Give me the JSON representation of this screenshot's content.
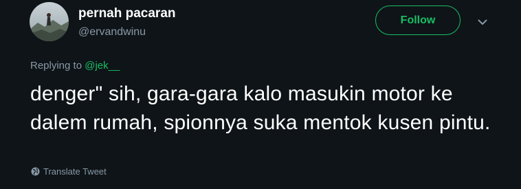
{
  "user": {
    "display_name": "pernah pacaran",
    "handle": "@ervandwinu"
  },
  "follow_button": {
    "label": "Follow"
  },
  "reply_context": {
    "prefix": "Replying to ",
    "mention": "@jek__"
  },
  "tweet": {
    "text": "denger\" sih, gara-gara kalo masukin motor ke dalem rumah, spionnya suka mentok kusen pintu."
  },
  "translate": {
    "label": "Translate Tweet"
  },
  "icons": {
    "avatar": "avatar-photo",
    "caret": "chevron-down-icon",
    "globe": "globe-icon"
  },
  "colors": {
    "background": "#0f1418",
    "accent": "#17bf63",
    "muted": "#8899a6",
    "text": "#ffffff"
  }
}
